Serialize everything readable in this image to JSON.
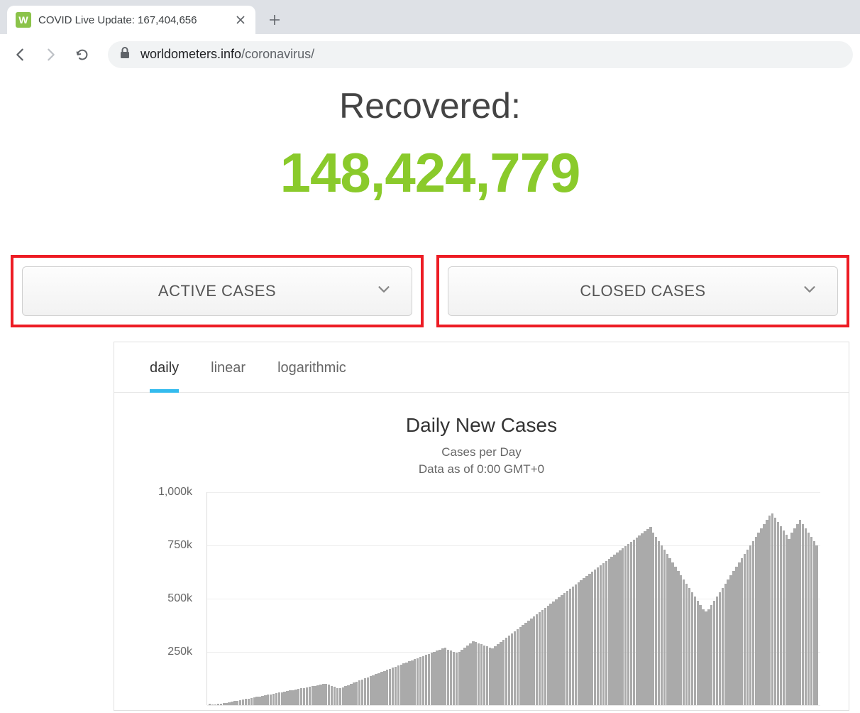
{
  "browser": {
    "tab_title": "COVID Live Update: 167,404,656",
    "favicon_letter": "W",
    "url_host": "worldometers.info",
    "url_path": "/coronavirus/"
  },
  "recovered": {
    "label": "Recovered:",
    "value": "148,424,779"
  },
  "panels": {
    "active_label": "ACTIVE CASES",
    "closed_label": "CLOSED CASES"
  },
  "chart": {
    "tabs": {
      "daily": "daily",
      "linear": "linear",
      "logarithmic": "logarithmic"
    },
    "title": "Daily New Cases",
    "subtitle_line1": "Cases per Day",
    "subtitle_line2": "Data as of 0:00 GMT+0",
    "y_ticks": [
      "1,000k",
      "750k",
      "500k",
      "250k"
    ]
  },
  "chart_data": {
    "type": "bar",
    "title": "Daily New Cases",
    "xlabel": "",
    "ylabel": "Cases per Day",
    "ylim": [
      0,
      1000000
    ],
    "values": [
      5000,
      2000,
      3000,
      4000,
      6000,
      8000,
      10000,
      12000,
      15000,
      18000,
      20000,
      22000,
      25000,
      28000,
      30000,
      32000,
      35000,
      38000,
      40000,
      42000,
      45000,
      48000,
      50000,
      52000,
      55000,
      58000,
      60000,
      62000,
      65000,
      68000,
      70000,
      72000,
      75000,
      78000,
      80000,
      82000,
      85000,
      88000,
      90000,
      92000,
      95000,
      98000,
      100000,
      95000,
      90000,
      85000,
      80000,
      78000,
      82000,
      88000,
      92000,
      98000,
      105000,
      110000,
      115000,
      120000,
      125000,
      130000,
      135000,
      140000,
      145000,
      150000,
      155000,
      160000,
      165000,
      170000,
      175000,
      180000,
      185000,
      190000,
      195000,
      200000,
      205000,
      210000,
      215000,
      220000,
      225000,
      230000,
      235000,
      240000,
      245000,
      250000,
      255000,
      260000,
      265000,
      270000,
      260000,
      255000,
      250000,
      245000,
      250000,
      260000,
      270000,
      280000,
      290000,
      300000,
      295000,
      290000,
      285000,
      280000,
      275000,
      270000,
      265000,
      275000,
      285000,
      295000,
      305000,
      315000,
      325000,
      335000,
      345000,
      355000,
      365000,
      375000,
      385000,
      395000,
      405000,
      415000,
      425000,
      435000,
      445000,
      455000,
      465000,
      475000,
      485000,
      495000,
      505000,
      515000,
      525000,
      535000,
      545000,
      555000,
      565000,
      575000,
      585000,
      595000,
      605000,
      615000,
      625000,
      635000,
      645000,
      655000,
      665000,
      675000,
      685000,
      695000,
      705000,
      715000,
      725000,
      735000,
      745000,
      755000,
      765000,
      775000,
      785000,
      795000,
      805000,
      815000,
      825000,
      835000,
      810000,
      790000,
      770000,
      750000,
      730000,
      710000,
      690000,
      670000,
      650000,
      630000,
      610000,
      590000,
      570000,
      550000,
      530000,
      510000,
      490000,
      470000,
      450000,
      440000,
      450000,
      470000,
      490000,
      510000,
      530000,
      550000,
      570000,
      590000,
      610000,
      630000,
      650000,
      670000,
      690000,
      710000,
      730000,
      750000,
      770000,
      790000,
      810000,
      830000,
      850000,
      870000,
      890000,
      900000,
      880000,
      860000,
      840000,
      820000,
      800000,
      780000,
      810000,
      830000,
      850000,
      870000,
      850000,
      830000,
      810000,
      790000,
      770000,
      750000
    ]
  }
}
